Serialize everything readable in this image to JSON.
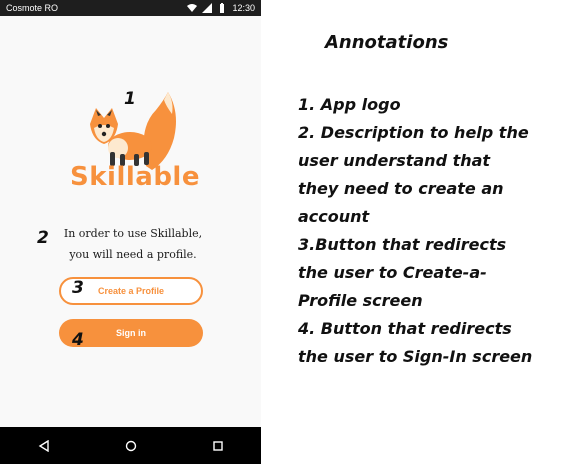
{
  "status_bar": {
    "carrier": "Cosmote RO",
    "time": "12:30"
  },
  "app": {
    "brand": "Skillable",
    "description_line1": "In order to use Skillable,",
    "description_line2": "you will need a profile.",
    "create_profile_label": "Create a Profile",
    "sign_in_label": "Sign in",
    "colors": {
      "accent": "#f7913d"
    }
  },
  "markers": {
    "m1": "1",
    "m2": "2",
    "m3": "3",
    "m4": "4"
  },
  "annotations": {
    "title": "Annotations",
    "lines": [
      "1. App logo",
      "2. Description to help the",
      "user understand that",
      "they need to create an",
      "account",
      "3.Button that redirects",
      "the user to Create-a-",
      "Profile screen",
      "4. Button that redirects",
      "the user to Sign-In screen"
    ]
  },
  "nav": {
    "icons": [
      "back-icon",
      "home-icon",
      "recents-icon"
    ]
  }
}
